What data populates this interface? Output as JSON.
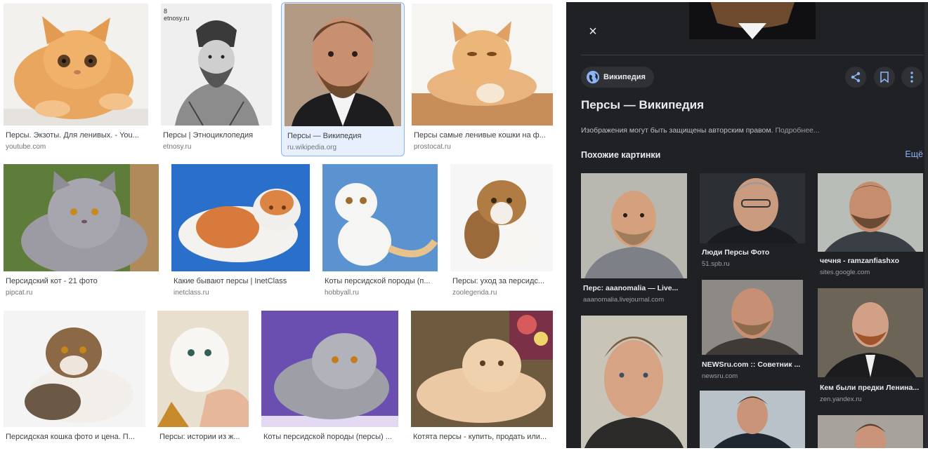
{
  "results": [
    {
      "caption": "Персы. Экзоты. Для ленивых. - You...",
      "source": "youtube.com",
      "icon": "orange-cat-photo"
    },
    {
      "caption": "Персы | Этноциклопедия",
      "source": "etnosy.ru",
      "icon": "engraving-portrait",
      "overlay": "8\netnosy.ru"
    },
    {
      "caption": "Персы — Википедия",
      "source": "ru.wikipedia.org",
      "icon": "bearded-man-photo"
    },
    {
      "caption": "Персы самые ленивые кошки на ф...",
      "source": "prostocat.ru",
      "icon": "ginger-cat-photo"
    },
    {
      "caption": "Персидский кот - 21 фото",
      "source": "pipcat.ru",
      "icon": "gray-cat-photo"
    },
    {
      "caption": "Какие бывают персы | InetClass",
      "source": "inetclass.ru",
      "icon": "red-white-cat-photo"
    },
    {
      "caption": "Коты персидской породы (п...",
      "source": "hobbyall.ru",
      "icon": "white-kitten-photo"
    },
    {
      "caption": "Персы: уход за персидс...",
      "source": "zoolegenda.ru",
      "icon": "fluffy-cat-photo"
    },
    {
      "caption": "Персидская кошка фото и цена. П...",
      "source": "",
      "icon": "tricolor-cat-photo"
    },
    {
      "caption": "Персы: истории из ж...",
      "source": "",
      "icon": "white-cat-hand-photo"
    },
    {
      "caption": "Коты персидской породы (персы) ...",
      "source": "",
      "icon": "silver-cat-photo"
    },
    {
      "caption": "Котята персы - купить, продать или...",
      "source": "",
      "icon": "kitten-photo"
    }
  ],
  "panel": {
    "close_label": "×",
    "source_chip": "Википедия",
    "title": "Персы — Википедия",
    "copyright_text": "Изображения могут быть защищены авторским правом.",
    "copyright_link": "Подробнее...",
    "similar_heading": "Похожие картинки",
    "more_label": "Ещё",
    "similar": [
      {
        "caption": "Перс: aaanomalia — Live...",
        "source": "aaanomalia.livejournal.com"
      },
      {
        "caption": "Люди Персы Фото",
        "source": "51.spb.ru"
      },
      {
        "caption": "чечня - ramzanfiashxo",
        "source": "sites.google.com"
      },
      {
        "caption": "NEWSru.com :: Советник ...",
        "source": "newsru.com"
      },
      {
        "caption": "Кем были предки Ленина...",
        "source": "zen.yandex.ru"
      },
      {
        "caption": "",
        "source": ""
      },
      {
        "caption": "",
        "source": ""
      },
      {
        "caption": "",
        "source": ""
      }
    ]
  },
  "colors": {
    "panel_bg": "#202124",
    "accent": "#8ab4f8",
    "selected_bg": "#e8f0fe"
  }
}
